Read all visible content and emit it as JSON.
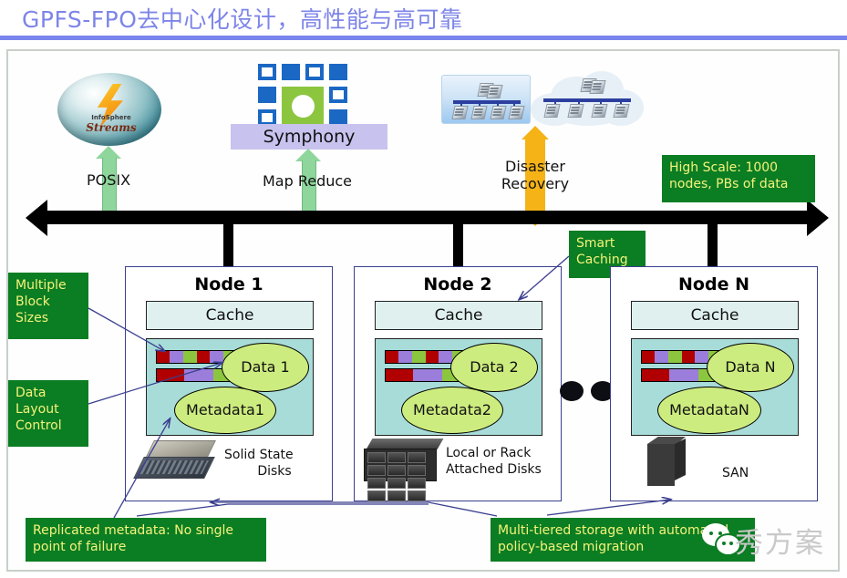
{
  "title": "GPFS-FPO去中心化设计，高性能与高可靠",
  "top_icons": {
    "streams": {
      "name": "InfoSphere Streams",
      "line1": "InfoSphere",
      "line2": "Streams"
    },
    "symphony": {
      "label": "Symphony"
    },
    "cluster_box": {
      "name": "cluster-icon"
    },
    "cloud": {
      "name": "cloud-cluster-icon"
    }
  },
  "interfaces": [
    {
      "label": "POSIX",
      "arrow": "green-double-arrow"
    },
    {
      "label": "Map Reduce",
      "arrow": "green-double-arrow"
    },
    {
      "label": "Disaster\nRecovery",
      "label_line1": "Disaster",
      "label_line2": "Recovery",
      "arrow": "orange-double-arrow"
    }
  ],
  "callouts": {
    "high_scale": {
      "line1": "High Scale: 1000",
      "line2": "nodes, PBs of data"
    },
    "multiple_block_sizes": {
      "line1": "Multiple",
      "line2": "Block",
      "line3": "Sizes"
    },
    "data_layout_control": {
      "line1": "Data",
      "line2": "Layout",
      "line3": "Control"
    },
    "smart_caching": {
      "line1": "Smart",
      "line2": "Caching"
    },
    "replicated_metadata": {
      "line1": "Replicated metadata: No single",
      "line2": "point of failure"
    },
    "multi_tiered": {
      "line1": "Multi-tiered storage with automated",
      "line2": "policy-based migration"
    }
  },
  "nodes": [
    {
      "title": "Node 1",
      "cache": "Cache",
      "data_label": "Data 1",
      "metadata_label": "Metadata1",
      "disk_label_line1": "Solid State",
      "disk_label_line2": "Disks",
      "disk_icon": "ssd-icon"
    },
    {
      "title": "Node 2",
      "cache": "Cache",
      "data_label": "Data 2",
      "metadata_label": "Metadata2",
      "disk_label_line1": "Local or Rack",
      "disk_label_line2": "Attached Disks",
      "disk_icon": "disk-rack-icon"
    },
    {
      "title": "Node N",
      "cache": "Cache",
      "data_label": "Data  N",
      "metadata_label": "MetadataN",
      "disk_label_line1": "SAN",
      "disk_label_line2": "",
      "disk_icon": "san-tower-icon"
    }
  ],
  "block_stripes": {
    "row1": [
      "#b00000",
      "#9b7ddb",
      "#8cc63f",
      "#b00000",
      "#9b7ddb",
      "#8cc63f"
    ],
    "row2": [
      "#b00000",
      "#9b7ddb",
      "#8cc63f"
    ]
  },
  "ellipsis": "two-dots",
  "watermark": {
    "text": "秀方案",
    "icon": "wechat-icon"
  },
  "colors": {
    "title": "#7d85e8",
    "rule": "#7b85ee",
    "callout_bg": "#0b7d23",
    "callout_text": "#f5f37a",
    "node_border": "#3c3f8f",
    "cache_bg": "#dff0ef",
    "store_bg": "#a8dcd9",
    "ellipse_bg": "#cdec7f",
    "green_arrow": "#8ed69b",
    "orange_arrow": "#f5b317",
    "bus": "#000000",
    "symphony_band": "#c7c2ee"
  }
}
